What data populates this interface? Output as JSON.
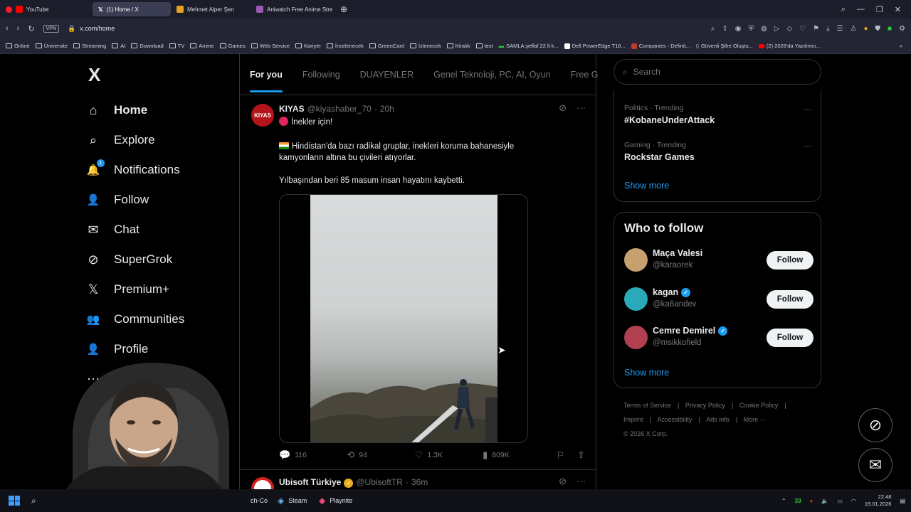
{
  "browser": {
    "tabs": [
      {
        "label": "YouTube",
        "color": "#ff0000",
        "active": false
      },
      {
        "label": "(1) Home / X",
        "color": "#ffffff",
        "active": true
      },
      {
        "label": "Mehmet Alper Şen",
        "color": "#e8a020",
        "active": false
      },
      {
        "label": "Aniwatch Free Anime Stre",
        "color": "#9b59b6",
        "active": false
      }
    ],
    "vpn_label": "VPN",
    "url": "x.com/home",
    "bookmarks": [
      "Online",
      "Üniversite",
      "Streaming",
      "AI",
      "Download",
      "TV",
      "Anime",
      "Games",
      "Web Service",
      "Kariyer",
      "İncelenecek",
      "GreenCard",
      "İzlenecek",
      "Kiralık",
      "test",
      "SAMLA şeffaf 22 lt k...",
      "Dell PowerEdge T16...",
      "Companies - Definit...",
      "Güvenli Şifre Oluştu...",
      "(2) 2026'da Yazılımcı..."
    ]
  },
  "sidebar": {
    "logo": "X",
    "items": [
      {
        "label": "Home",
        "icon": "home-icon",
        "glyph": "⌂"
      },
      {
        "label": "Explore",
        "icon": "search-icon",
        "glyph": "⌕"
      },
      {
        "label": "Notifications",
        "icon": "bell-icon",
        "glyph": "🔔",
        "badge": "1"
      },
      {
        "label": "Follow",
        "icon": "add-person-icon",
        "glyph": "👤"
      },
      {
        "label": "Chat",
        "icon": "mail-icon",
        "glyph": "✉"
      },
      {
        "label": "SuperGrok",
        "icon": "grok-icon",
        "glyph": "⊘"
      },
      {
        "label": "Premium+",
        "icon": "x-icon",
        "glyph": "𝕏"
      },
      {
        "label": "Communities",
        "icon": "communities-icon",
        "glyph": "👥"
      },
      {
        "label": "Profile",
        "icon": "profile-icon",
        "glyph": "👤"
      },
      {
        "label": "More",
        "icon": "more-icon",
        "glyph": "⋯"
      }
    ]
  },
  "feed": {
    "tabs": [
      "For you",
      "Following",
      "DUAYENLER",
      "Genel Teknoloji, PC, AI, Oyun",
      "Free G"
    ],
    "tweet": {
      "avatar_text": "KIYAS",
      "name": "KIYAS",
      "handle": "@kiyashaber_70",
      "time": "20h",
      "line1": "İnekler için!",
      "line2": "Hindistan'da bazı radikal gruplar, inekleri koruma bahanesiyle kamyonların altına bu çivileri atıyorlar.",
      "line3": "Yılbaşından beri 85 masum insan hayatını kaybetti.",
      "replies": "116",
      "reposts": "94",
      "likes": "1.3K",
      "views": "809K"
    },
    "tweet2": {
      "name": "Ubisoft Türkiye",
      "handle": "@UbisoftTR",
      "time": "36m"
    }
  },
  "right": {
    "search_placeholder": "Search",
    "trends": [
      {
        "category": "Politics · Trending",
        "title": "#KobaneUnderAttack"
      },
      {
        "category": "Gaming · Trending",
        "title": "Rockstar Games"
      }
    ],
    "show_more": "Show more",
    "who_to_follow_title": "Who to follow",
    "users": [
      {
        "name": "Maça Valesi",
        "handle": "@karaorek",
        "verified": false,
        "color": "#c8a070"
      },
      {
        "name": "kagan",
        "handle": "@ka6andev",
        "verified": true,
        "color": "#2aa9b8"
      },
      {
        "name": "Cemre Demirel",
        "handle": "@msikkofield",
        "verified": true,
        "color": "#b04050"
      }
    ],
    "follow_label": "Follow",
    "footer": [
      "Terms of Service",
      "Privacy Policy",
      "Cookie Policy",
      "Imprint",
      "Accessibility",
      "Ads info",
      "More ···",
      "© 2026 X Corp."
    ]
  },
  "taskbar": {
    "apps": [
      "Steam",
      "Playnite"
    ],
    "partial_app": "ch-Co",
    "tray_count": "33",
    "time": "22:48",
    "date": "19.01.2026"
  }
}
